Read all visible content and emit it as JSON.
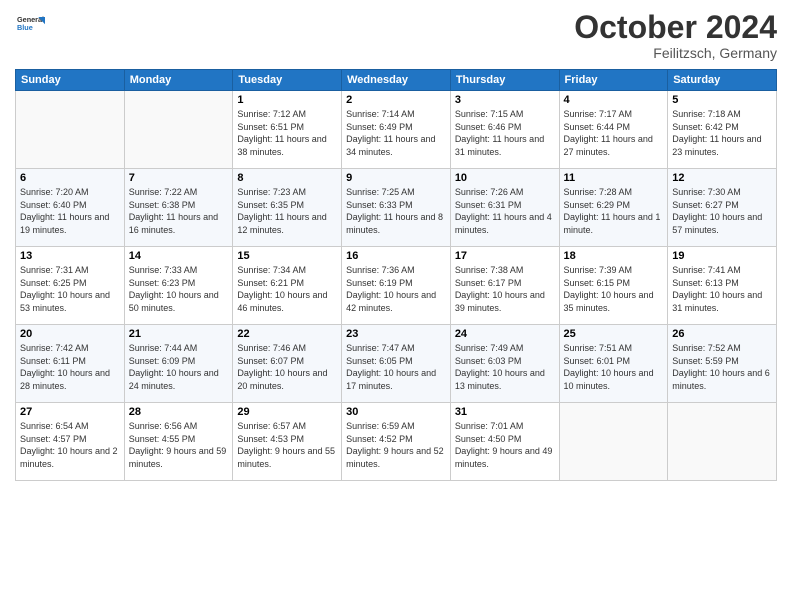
{
  "header": {
    "logo_line1": "General",
    "logo_line2": "Blue",
    "month": "October 2024",
    "location": "Feilitzsch, Germany"
  },
  "weekdays": [
    "Sunday",
    "Monday",
    "Tuesday",
    "Wednesday",
    "Thursday",
    "Friday",
    "Saturday"
  ],
  "weeks": [
    [
      {
        "day": "",
        "info": ""
      },
      {
        "day": "",
        "info": ""
      },
      {
        "day": "1",
        "info": "Sunrise: 7:12 AM\nSunset: 6:51 PM\nDaylight: 11 hours and 38 minutes."
      },
      {
        "day": "2",
        "info": "Sunrise: 7:14 AM\nSunset: 6:49 PM\nDaylight: 11 hours and 34 minutes."
      },
      {
        "day": "3",
        "info": "Sunrise: 7:15 AM\nSunset: 6:46 PM\nDaylight: 11 hours and 31 minutes."
      },
      {
        "day": "4",
        "info": "Sunrise: 7:17 AM\nSunset: 6:44 PM\nDaylight: 11 hours and 27 minutes."
      },
      {
        "day": "5",
        "info": "Sunrise: 7:18 AM\nSunset: 6:42 PM\nDaylight: 11 hours and 23 minutes."
      }
    ],
    [
      {
        "day": "6",
        "info": "Sunrise: 7:20 AM\nSunset: 6:40 PM\nDaylight: 11 hours and 19 minutes."
      },
      {
        "day": "7",
        "info": "Sunrise: 7:22 AM\nSunset: 6:38 PM\nDaylight: 11 hours and 16 minutes."
      },
      {
        "day": "8",
        "info": "Sunrise: 7:23 AM\nSunset: 6:35 PM\nDaylight: 11 hours and 12 minutes."
      },
      {
        "day": "9",
        "info": "Sunrise: 7:25 AM\nSunset: 6:33 PM\nDaylight: 11 hours and 8 minutes."
      },
      {
        "day": "10",
        "info": "Sunrise: 7:26 AM\nSunset: 6:31 PM\nDaylight: 11 hours and 4 minutes."
      },
      {
        "day": "11",
        "info": "Sunrise: 7:28 AM\nSunset: 6:29 PM\nDaylight: 11 hours and 1 minute."
      },
      {
        "day": "12",
        "info": "Sunrise: 7:30 AM\nSunset: 6:27 PM\nDaylight: 10 hours and 57 minutes."
      }
    ],
    [
      {
        "day": "13",
        "info": "Sunrise: 7:31 AM\nSunset: 6:25 PM\nDaylight: 10 hours and 53 minutes."
      },
      {
        "day": "14",
        "info": "Sunrise: 7:33 AM\nSunset: 6:23 PM\nDaylight: 10 hours and 50 minutes."
      },
      {
        "day": "15",
        "info": "Sunrise: 7:34 AM\nSunset: 6:21 PM\nDaylight: 10 hours and 46 minutes."
      },
      {
        "day": "16",
        "info": "Sunrise: 7:36 AM\nSunset: 6:19 PM\nDaylight: 10 hours and 42 minutes."
      },
      {
        "day": "17",
        "info": "Sunrise: 7:38 AM\nSunset: 6:17 PM\nDaylight: 10 hours and 39 minutes."
      },
      {
        "day": "18",
        "info": "Sunrise: 7:39 AM\nSunset: 6:15 PM\nDaylight: 10 hours and 35 minutes."
      },
      {
        "day": "19",
        "info": "Sunrise: 7:41 AM\nSunset: 6:13 PM\nDaylight: 10 hours and 31 minutes."
      }
    ],
    [
      {
        "day": "20",
        "info": "Sunrise: 7:42 AM\nSunset: 6:11 PM\nDaylight: 10 hours and 28 minutes."
      },
      {
        "day": "21",
        "info": "Sunrise: 7:44 AM\nSunset: 6:09 PM\nDaylight: 10 hours and 24 minutes."
      },
      {
        "day": "22",
        "info": "Sunrise: 7:46 AM\nSunset: 6:07 PM\nDaylight: 10 hours and 20 minutes."
      },
      {
        "day": "23",
        "info": "Sunrise: 7:47 AM\nSunset: 6:05 PM\nDaylight: 10 hours and 17 minutes."
      },
      {
        "day": "24",
        "info": "Sunrise: 7:49 AM\nSunset: 6:03 PM\nDaylight: 10 hours and 13 minutes."
      },
      {
        "day": "25",
        "info": "Sunrise: 7:51 AM\nSunset: 6:01 PM\nDaylight: 10 hours and 10 minutes."
      },
      {
        "day": "26",
        "info": "Sunrise: 7:52 AM\nSunset: 5:59 PM\nDaylight: 10 hours and 6 minutes."
      }
    ],
    [
      {
        "day": "27",
        "info": "Sunrise: 6:54 AM\nSunset: 4:57 PM\nDaylight: 10 hours and 2 minutes."
      },
      {
        "day": "28",
        "info": "Sunrise: 6:56 AM\nSunset: 4:55 PM\nDaylight: 9 hours and 59 minutes."
      },
      {
        "day": "29",
        "info": "Sunrise: 6:57 AM\nSunset: 4:53 PM\nDaylight: 9 hours and 55 minutes."
      },
      {
        "day": "30",
        "info": "Sunrise: 6:59 AM\nSunset: 4:52 PM\nDaylight: 9 hours and 52 minutes."
      },
      {
        "day": "31",
        "info": "Sunrise: 7:01 AM\nSunset: 4:50 PM\nDaylight: 9 hours and 49 minutes."
      },
      {
        "day": "",
        "info": ""
      },
      {
        "day": "",
        "info": ""
      }
    ]
  ]
}
